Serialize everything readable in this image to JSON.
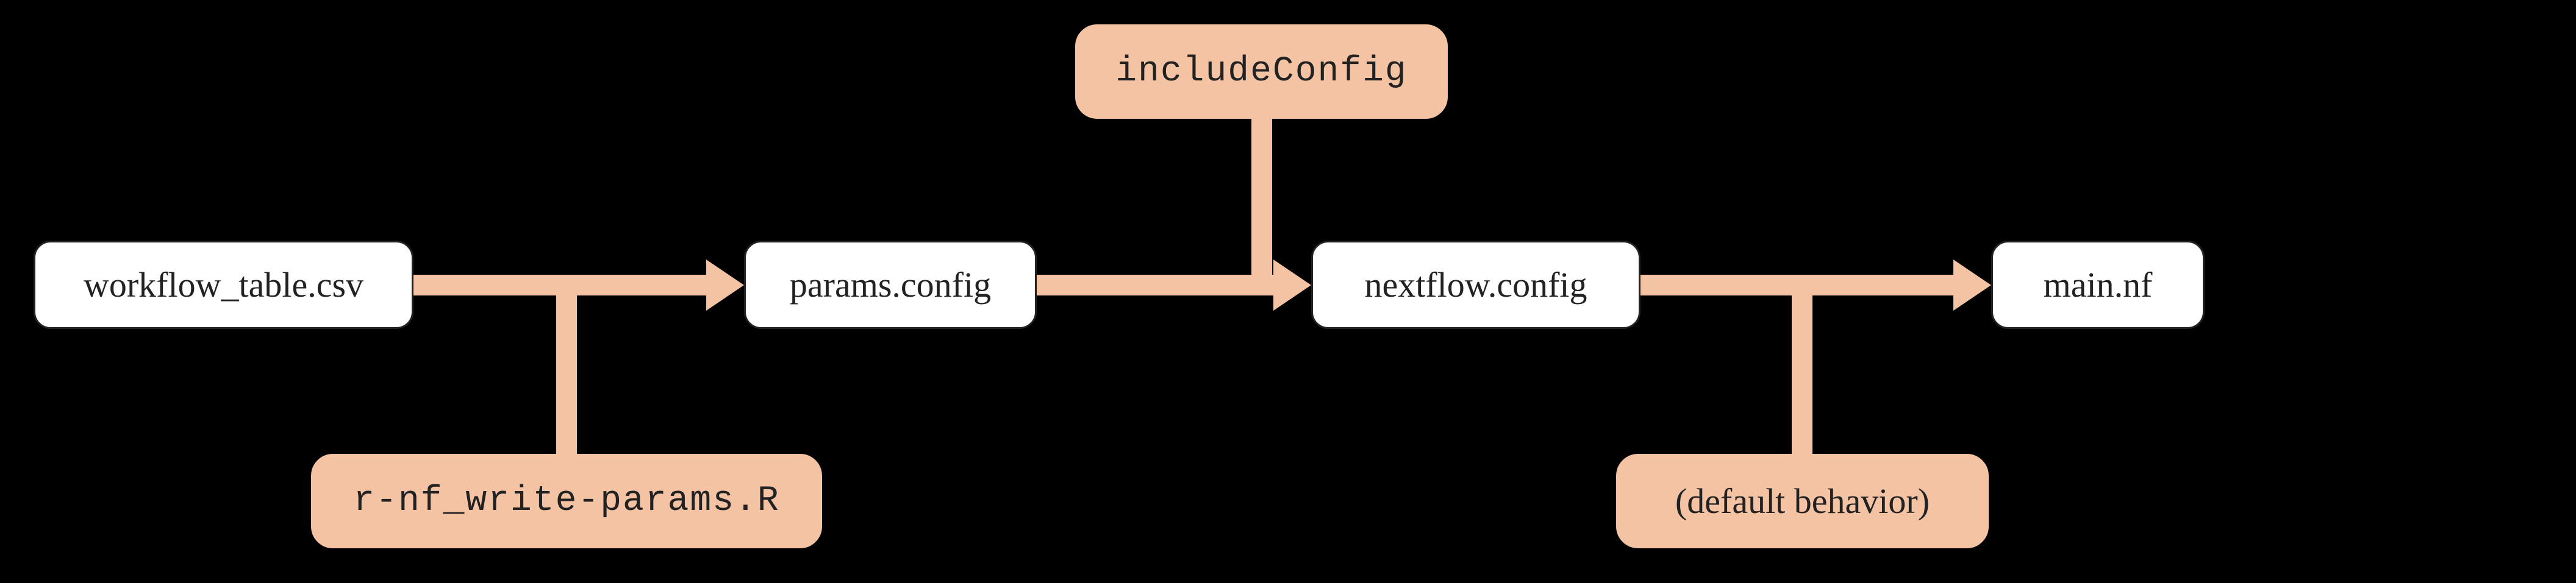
{
  "nodes": {
    "workflow_table": "workflow_table.csv",
    "params_config": "params.config",
    "nextflow_config": "nextflow.config",
    "main_nf": "main.nf",
    "include_config": "includeConfig",
    "write_params": "r-nf_write-params.R",
    "default_behavior": "(default behavior)"
  }
}
